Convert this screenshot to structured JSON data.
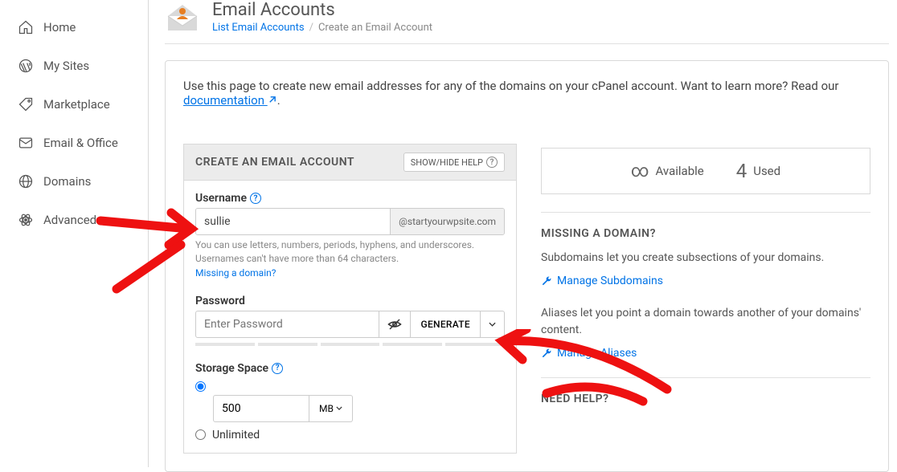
{
  "sidebar": {
    "items": [
      {
        "label": "Home",
        "icon": "home"
      },
      {
        "label": "My Sites",
        "icon": "wordpress"
      },
      {
        "label": "Marketplace",
        "icon": "tag"
      },
      {
        "label": "Email & Office",
        "icon": "mail"
      },
      {
        "label": "Domains",
        "icon": "globe"
      },
      {
        "label": "Advanced",
        "icon": "atom"
      }
    ]
  },
  "header": {
    "title": "Email Accounts",
    "breadcrumb_link": "List Email Accounts",
    "breadcrumb_current": "Create an Email Account"
  },
  "intro": {
    "text_before": "Use this page to create new email addresses for any of the domains on your cPanel account. Want to learn more? Read our ",
    "link": "documentation",
    "text_after": "."
  },
  "panel": {
    "title": "CREATE AN EMAIL ACCOUNT",
    "help_button": "SHOW/HIDE HELP",
    "username_label": "Username",
    "username_value": "sullie",
    "domain_value": "@startyourwpsite.com",
    "username_help": "You can use letters, numbers, periods, hyphens, and underscores. Usernames can't have more than 64 characters.",
    "missing_domain_link": "Missing a domain?",
    "password_label": "Password",
    "password_placeholder": "Enter Password",
    "generate_label": "GENERATE",
    "storage_label": "Storage Space",
    "storage_value": "500",
    "storage_unit": "MB",
    "unlimited_label": "Unlimited"
  },
  "stats": {
    "avail_label": "Available",
    "avail_value": "∞",
    "used_label": "Used",
    "used_value": "4"
  },
  "missing": {
    "title": "MISSING A DOMAIN?",
    "subdomain_text": "Subdomains let you create subsections of your domains.",
    "manage_sub": "Manage Subdomains",
    "alias_text": "Aliases let you point a domain towards another of your domains' content.",
    "manage_alias": "Manage Aliases"
  },
  "help": {
    "title": "NEED HELP?"
  }
}
